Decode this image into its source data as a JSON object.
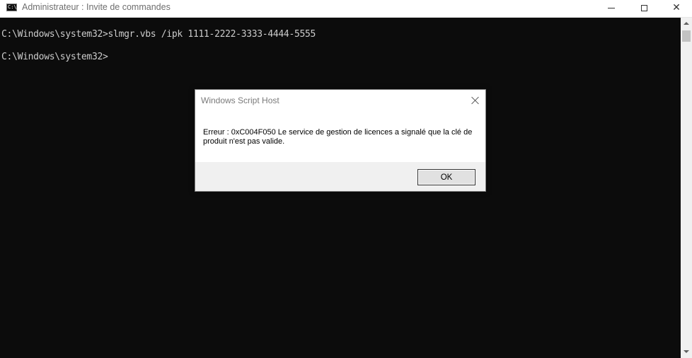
{
  "window": {
    "title": "Administrateur : Invite de commandes",
    "icon": "cmd-icon",
    "icon_text": "C:\\",
    "controls": [
      "minimize-icon",
      "maximize-icon",
      "close-icon"
    ],
    "close_glyph": "✕"
  },
  "console": {
    "background": "#0c0c0c",
    "text_color": "#cccccc",
    "lines": [
      "C:\\Windows\\system32>slmgr.vbs /ipk 1111-2222-3333-4444-5555",
      "C:\\Windows\\system32>"
    ]
  },
  "dialog": {
    "title": "Windows Script Host",
    "message": "Erreur : 0xC004F050 Le service de gestion de licences a signalé que la clé de produit n'est pas valide.",
    "ok_label": "OK",
    "close_icon": "close-icon"
  }
}
